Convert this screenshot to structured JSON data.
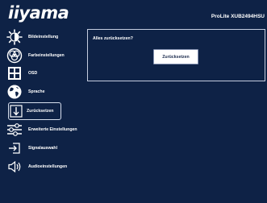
{
  "header": {
    "logo": "iiyama",
    "model": "ProLite XUB2494HSU"
  },
  "menu": {
    "items": [
      {
        "label": "Bildeinstellung",
        "icon": "sun-icon"
      },
      {
        "label": "Farbeinstellungen",
        "icon": "color-circles-icon"
      },
      {
        "label": "OSD",
        "icon": "osd-grid-icon"
      },
      {
        "label": "Sprache",
        "icon": "globe-icon"
      },
      {
        "label": "Zurücksetzen",
        "icon": "reset-icon",
        "selected": true
      },
      {
        "label": "Erweiterte Einstellungen",
        "icon": "sliders-icon"
      },
      {
        "label": "Signalauswahl",
        "icon": "input-icon"
      },
      {
        "label": "Audioeinstellungen",
        "icon": "speaker-icon"
      }
    ]
  },
  "panel": {
    "question": "Alles zurücksetzen?",
    "button_label": "Zurücksetzen"
  },
  "colors": {
    "background": "#0e2246",
    "text": "#ffffff",
    "border": "#c5cde0"
  }
}
